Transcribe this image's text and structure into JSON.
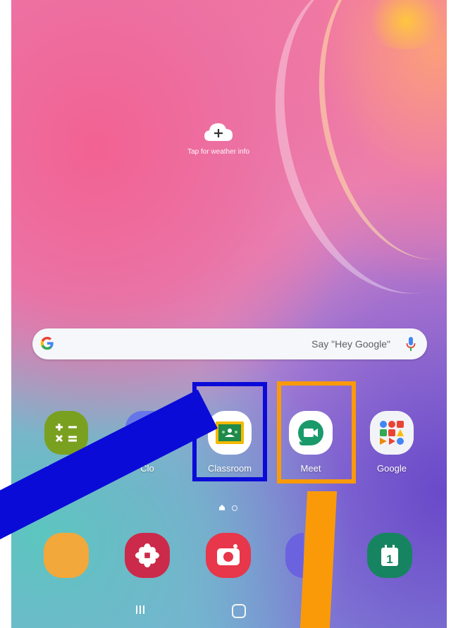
{
  "weather": {
    "hint": "Tap for weather info"
  },
  "search": {
    "hint": "Say \"Hey Google\""
  },
  "apps": [
    {
      "label": "Calculator",
      "icon": "calculator-icon"
    },
    {
      "label": "Clo",
      "icon": "clock-icon"
    },
    {
      "label": "Classroom",
      "icon": "classroom-icon"
    },
    {
      "label": "Meet",
      "icon": "meet-icon"
    },
    {
      "label": "Google",
      "icon": "google-folder-icon"
    }
  ],
  "dock": [
    {
      "icon": "partial-app-icon"
    },
    {
      "icon": "gallery-flower-icon"
    },
    {
      "icon": "camera-icon"
    },
    {
      "icon": "internet-browser-icon"
    },
    {
      "icon": "calendar-icon",
      "date": "1"
    }
  ],
  "colors": {
    "highlight_blue": "#0b0bd8",
    "highlight_orange": "#fb9a08"
  }
}
